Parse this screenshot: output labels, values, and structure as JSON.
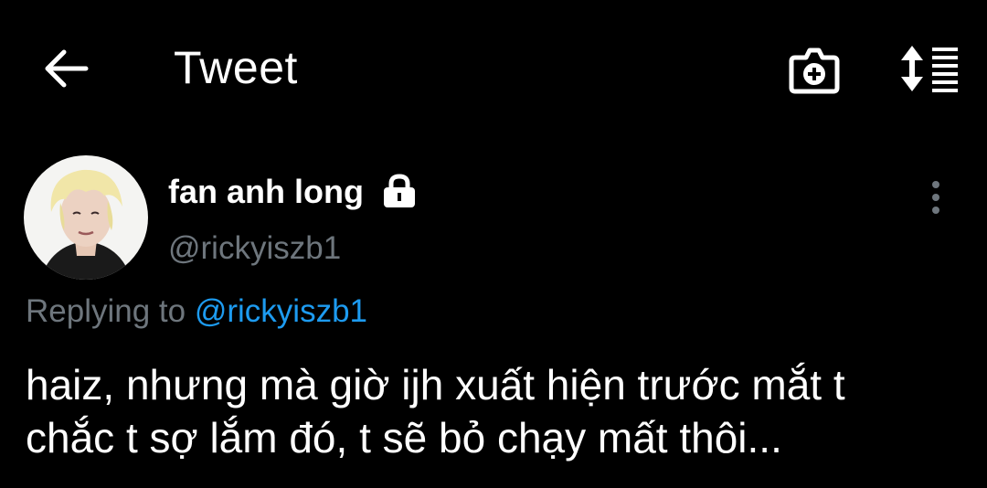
{
  "header": {
    "back_icon": "arrow-left-icon",
    "title": "Tweet",
    "camera_icon": "camera-plus-icon",
    "sort_icon": "sort-list-icon"
  },
  "tweet": {
    "author": {
      "display_name": "fan anh long",
      "protected_icon": "lock-icon",
      "handle": "@rickyiszb1"
    },
    "more_icon": "more-vertical-icon",
    "replying_to": {
      "prefix": "Replying to",
      "handle": "@rickyiszb1"
    },
    "text_lines": [
      "haiz, nhưng mà giờ ijh xuất hiện trước mắt t",
      "chắc t sợ lắm đó, t sẽ bỏ chạy mất thôi..."
    ]
  },
  "colors": {
    "background": "#000000",
    "primary_text": "#ffffff",
    "secondary_text": "#6e767d",
    "link": "#1d9bf0"
  }
}
